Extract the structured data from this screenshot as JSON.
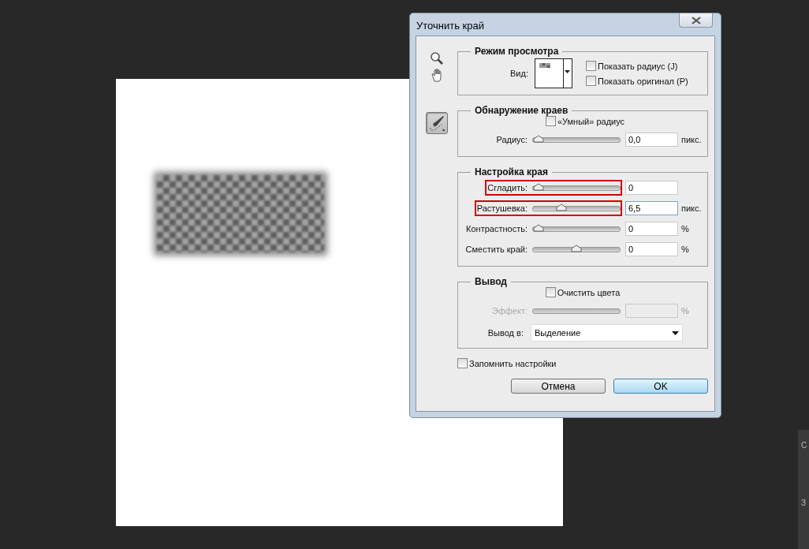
{
  "dialog": {
    "title": "Уточнить край",
    "tools": [
      {
        "kind": "zoom",
        "selected": false
      },
      {
        "kind": "hand",
        "selected": false
      },
      {
        "kind": "brush",
        "selected": true
      }
    ],
    "view_mode": {
      "legend": "Режим просмотра",
      "view_label": "Вид:",
      "options": [
        {
          "label": "Показать радиус (J)",
          "checked": false
        },
        {
          "label": "Показать оригинал (P)",
          "checked": false
        }
      ]
    },
    "edge_detection": {
      "legend": "Обнаружение краев",
      "smart_radius": {
        "label": "«Умный» радиус",
        "checked": false
      },
      "sliders": [
        {
          "label": "Радиус:",
          "level": 0,
          "value": "0,0",
          "unit": "пикс.",
          "highlighted": false,
          "focused": false
        }
      ]
    },
    "adjust_edge": {
      "legend": "Настройка края",
      "sliders": [
        {
          "label": "Сгладить:",
          "level": 0,
          "value": "0",
          "highlighted": true,
          "focused": false
        },
        {
          "label": "Растушевка:",
          "level": 0.3,
          "value": "6,5",
          "unit": "пикс.",
          "highlighted": true,
          "focused": true
        },
        {
          "label": "Контрастность:",
          "level": 0,
          "value": "0",
          "unit": "%",
          "highlighted": false,
          "focused": false
        },
        {
          "label": "Сместить край:",
          "level": 0.5,
          "value": "0",
          "unit": "%",
          "highlighted": false,
          "focused": false
        }
      ]
    },
    "output": {
      "legend": "Вывод",
      "decontaminate": {
        "label": "Очистить цвета",
        "checked": false
      },
      "amount": {
        "label": "Эффект:",
        "unit": "%",
        "disabled": true
      },
      "output_to": {
        "label": "Вывод в:",
        "value": "Выделение"
      }
    },
    "remember": {
      "label": "Запомнить настройки",
      "checked": false
    },
    "buttons": [
      {
        "label": "Отмена",
        "default": false
      },
      {
        "label": "OK",
        "default": true
      }
    ]
  },
  "side_panel": {
    "texts": [
      "С",
      "З"
    ]
  }
}
